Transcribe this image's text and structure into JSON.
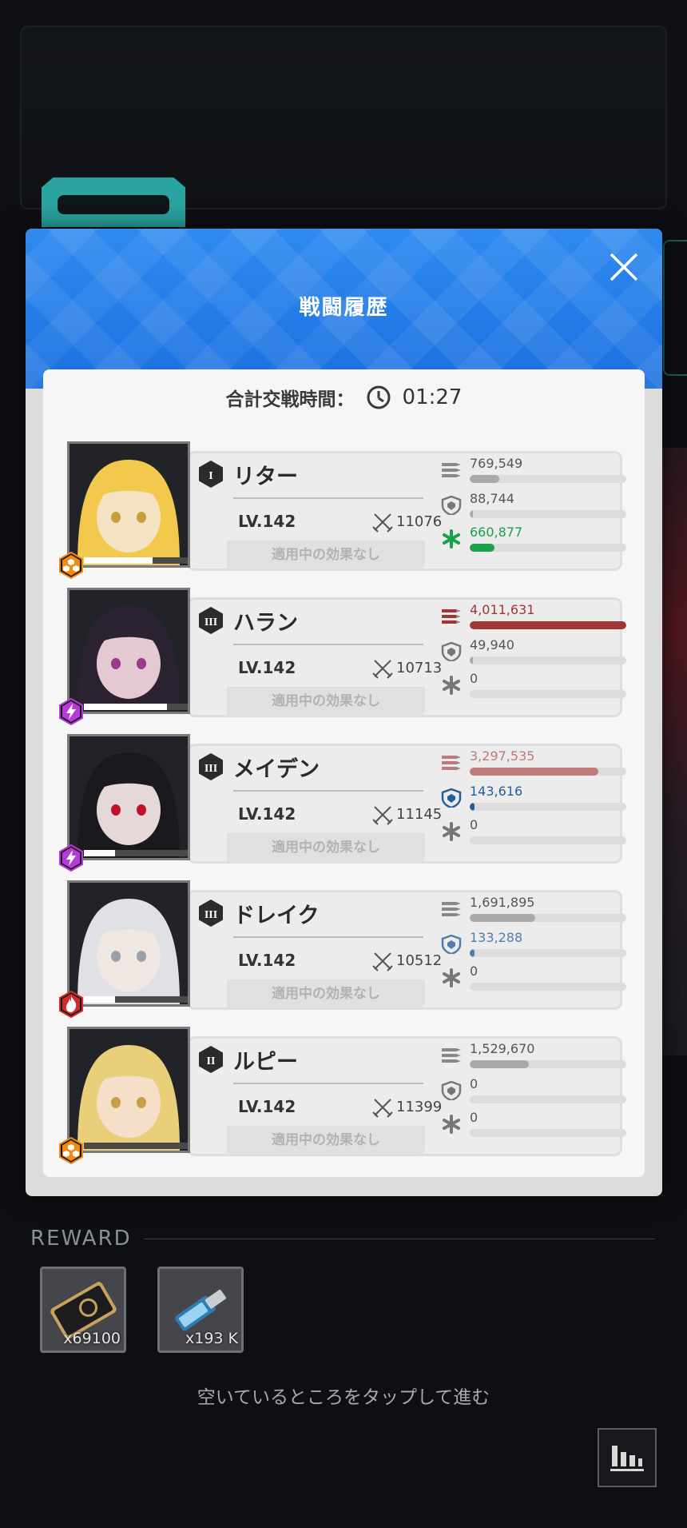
{
  "dialog": {
    "title": "戦闘履歴",
    "total_time_label": "合計交戦時間：",
    "total_time": "01:27"
  },
  "characters": [
    {
      "burst": "I",
      "name": "リター",
      "level": "LV.142",
      "power": "11076",
      "effect": "適用中の効果なし",
      "element": "iron",
      "element_color": "#f08a12",
      "damage": "769,549",
      "damage_fraction": 0.19,
      "damage_color": "#a9a9a9",
      "damage_taken": "88,744",
      "damage_taken_fraction": 0.02,
      "damage_taken_color": "#a9a9a9",
      "healing": "660,877",
      "healing_fraction": 0.16,
      "healing_color": "#18a24a",
      "hp_fraction": 0.66
    },
    {
      "burst": "III",
      "name": "ハラン",
      "level": "LV.142",
      "power": "10713",
      "effect": "適用中の効果なし",
      "element": "electric",
      "element_color": "#b43bd6",
      "damage": "4,011,631",
      "damage_fraction": 1.0,
      "damage_color": "#a33535",
      "damage_taken": "49,940",
      "damage_taken_fraction": 0.01,
      "damage_taken_color": "#a9a9a9",
      "healing": "0",
      "healing_fraction": 0,
      "healing_color": "#a9a9a9",
      "hp_fraction": 0.8
    },
    {
      "burst": "III",
      "name": "メイデン",
      "level": "LV.142",
      "power": "11145",
      "effect": "適用中の効果なし",
      "element": "electric",
      "element_color": "#b43bd6",
      "damage": "3,297,535",
      "damage_fraction": 0.82,
      "damage_color": "#c07a7a",
      "damage_taken": "143,616",
      "damage_taken_fraction": 0.03,
      "damage_taken_color": "#225f9a",
      "healing": "0",
      "healing_fraction": 0,
      "healing_color": "#a9a9a9",
      "hp_fraction": 0.3
    },
    {
      "burst": "III",
      "name": "ドレイク",
      "level": "LV.142",
      "power": "10512",
      "effect": "適用中の効果なし",
      "element": "fire",
      "element_color": "#d02a2a",
      "damage": "1,691,895",
      "damage_fraction": 0.42,
      "damage_color": "#a9a9a9",
      "damage_taken": "133,288",
      "damage_taken_fraction": 0.03,
      "damage_taken_color": "#4f7ea8",
      "healing": "0",
      "healing_fraction": 0,
      "healing_color": "#a9a9a9",
      "hp_fraction": 0.3
    },
    {
      "burst": "II",
      "name": "ルピー",
      "level": "LV.142",
      "power": "11399",
      "effect": "適用中の効果なし",
      "element": "iron",
      "element_color": "#f08a12",
      "damage": "1,529,670",
      "damage_fraction": 0.38,
      "damage_color": "#a9a9a9",
      "damage_taken": "0",
      "damage_taken_fraction": 0,
      "damage_taken_color": "#a9a9a9",
      "healing": "0",
      "healing_fraction": 0,
      "healing_color": "#a9a9a9",
      "hp_fraction": 0.0
    }
  ],
  "reward": {
    "label": "REWARD",
    "items": [
      {
        "icon": "credit-card-icon",
        "count": "x69100"
      },
      {
        "icon": "data-drive-icon",
        "count": "x193 K"
      }
    ]
  },
  "tap_hint": "空いているところをタップして進む",
  "icons": {
    "close": "close-icon",
    "clock": "clock-icon",
    "damage": "bullets-icon",
    "damage_taken": "shield-icon",
    "healing": "heal-icon",
    "power": "crossed-swords-icon",
    "stats": "bar-chart-icon"
  }
}
